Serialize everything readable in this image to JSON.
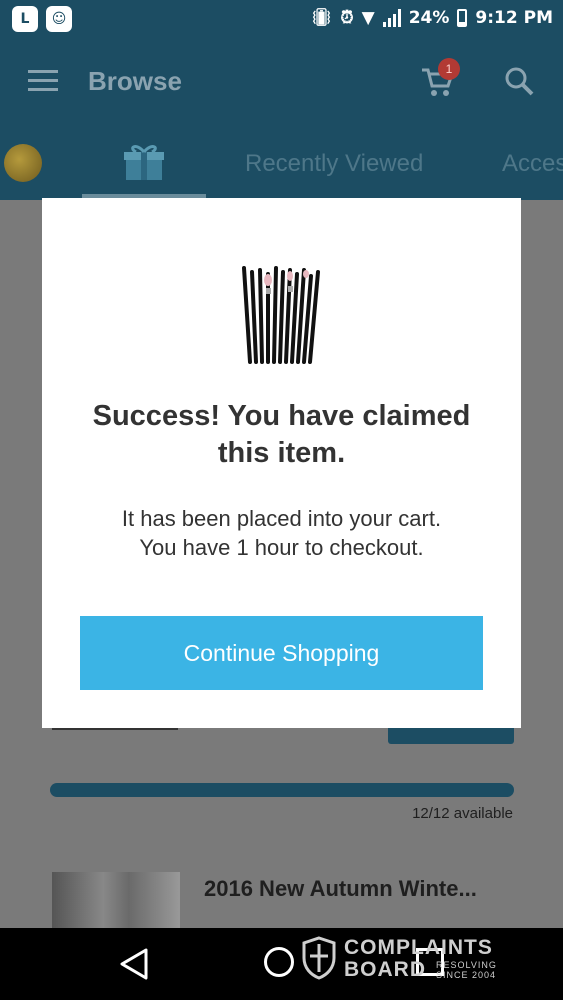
{
  "status_bar": {
    "app_icons": [
      "L",
      "☺"
    ],
    "battery": "24%",
    "time": "9:12 PM"
  },
  "toolbar": {
    "title": "Browse",
    "cart_badge": "1"
  },
  "tabs": {
    "items": [
      {
        "label": "Recently Viewed"
      },
      {
        "label": "Acces"
      }
    ]
  },
  "background": {
    "availability": "12/12 available",
    "product_title": "2016 New Autumn  Winte..."
  },
  "modal": {
    "title_line1": "Success! You have claimed",
    "title_line2": "this item.",
    "message_line1": "It has been placed into your cart.",
    "message_line2": "You have 1 hour to checkout.",
    "button_label": "Continue Shopping",
    "button_color": "#3bb4e5"
  },
  "watermark": {
    "line1": "COMPLAINTS",
    "line2": "BOARD",
    "tag_line1": "RESOLVING",
    "tag_line2": "SINCE 2004"
  },
  "colors": {
    "primary": "#1c4d63",
    "accent": "#3bb4e5",
    "badge": "#b23a34"
  }
}
